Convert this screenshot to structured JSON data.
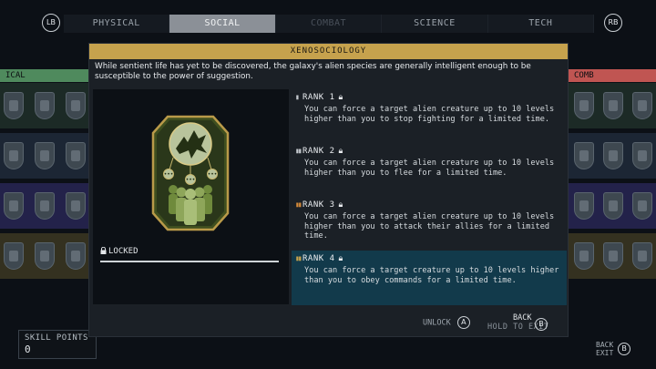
{
  "topbar": {
    "left_button": "LB",
    "right_button": "RB",
    "tabs": [
      "PHYSICAL",
      "SOCIAL",
      "COMBAT",
      "SCIENCE",
      "TECH"
    ],
    "active_tab": "SOCIAL"
  },
  "background": {
    "left_header": "ICAL",
    "right_header": "COMB",
    "row_colors": [
      "#2c4a3c",
      "#2b3a4e",
      "#37356a",
      "#5b5432"
    ],
    "header_colors": {
      "left": "#4f8a5d",
      "right": "#c05552"
    }
  },
  "skill_points": {
    "label": "SKILL POINTS",
    "value": "0"
  },
  "modal": {
    "title": "XENOSOCIOLOGY",
    "description": "While sentient life has yet to be discovered, the galaxy's alien species are generally intelligent enough to be susceptible to the power of suggestion.",
    "status_icon": "lock-icon",
    "status": "LOCKED",
    "ranks": [
      {
        "title": "RANK 1",
        "desc": "You can force a target alien creature up to 10 levels higher than you to stop fighting for a limited time."
      },
      {
        "title": "RANK 2",
        "desc": "You can force a target alien creature up to 10 levels higher than you to flee for a limited time."
      },
      {
        "title": "RANK 3",
        "desc": "You can force a target alien creature up to 10 levels higher than you to attack their allies for a limited time."
      },
      {
        "title": "RANK 4",
        "desc": "You can force a target creature up to 10 levels higher than you to obey commands for a limited time."
      }
    ],
    "selected_rank": 4,
    "footer": {
      "unlock_label": "UNLOCK",
      "unlock_button": "A",
      "back_label": "BACK",
      "hold_exit_label": "HOLD TO EXIT",
      "back_button": "B"
    }
  },
  "bottom_right": {
    "back": "BACK",
    "exit": "EXIT",
    "button": "B"
  },
  "colors": {
    "accent_gold": "#c6a24d",
    "selected_row": "#123a4b",
    "tab_active": "#8b9097"
  }
}
